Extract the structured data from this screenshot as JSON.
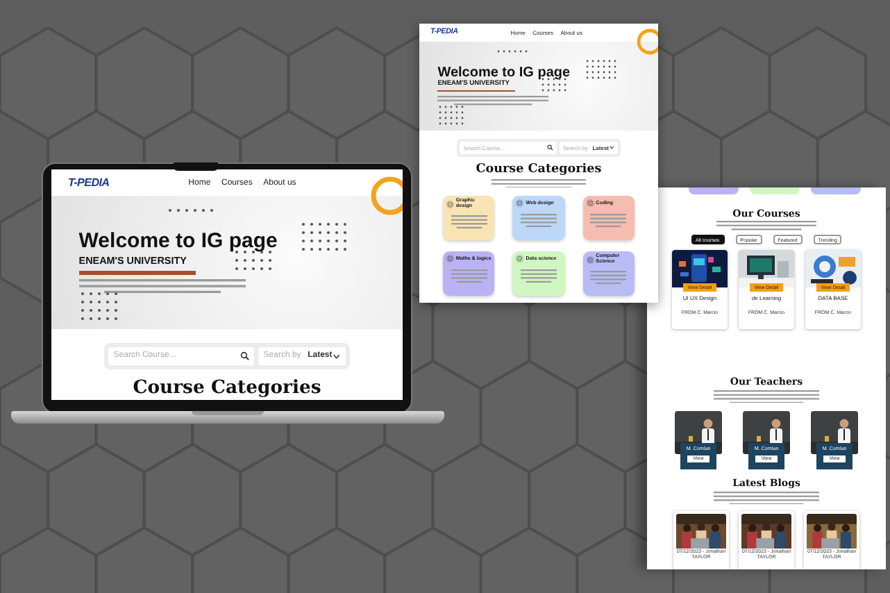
{
  "laptop_page": {
    "logo": "T-PEDIA",
    "nav": [
      {
        "label": "Home"
      },
      {
        "label": "Courses"
      },
      {
        "label": "About us"
      }
    ],
    "hero": {
      "title": "Welcome to IG page",
      "subtitle": "ENEAM'S UNIVERSITY"
    },
    "search": {
      "placeholder": "Search Course...",
      "sort_label": "Search by",
      "sort_value": "Latest"
    },
    "section_title": "Course Categories"
  },
  "preview_page_top": {
    "logo": "T-PEDIA",
    "nav": [
      {
        "label": "Home"
      },
      {
        "label": "Courses"
      },
      {
        "label": "About us"
      }
    ],
    "hero": {
      "title": "Welcome to IG page",
      "subtitle": "ENEAM'S UNIVERSITY"
    },
    "search": {
      "placeholder": "Search Course...",
      "sort_label": "Search by",
      "sort_value": "Latest"
    },
    "section_title": "Course Categories",
    "categories": [
      {
        "name": "Graphic design",
        "color": "#f9e4b4"
      },
      {
        "name": "Web design",
        "color": "#bcd7f8"
      },
      {
        "name": "Coding",
        "color": "#f7bcb0"
      },
      {
        "name": "Maths & logics",
        "color": "#b9b3f4"
      },
      {
        "name": "Data science",
        "color": "#d0f7c2"
      },
      {
        "name": "Computer Science",
        "color": "#b7bcf6"
      }
    ]
  },
  "preview_page_bottom": {
    "category_cards": [
      {
        "color": "#b9b3f4"
      },
      {
        "color": "#d0f7c2"
      },
      {
        "color": "#b7bcf6"
      }
    ],
    "courses_title": "Our Courses",
    "filters": [
      {
        "label": "All courses",
        "selected": true
      },
      {
        "label": "Popular",
        "selected": false
      },
      {
        "label": "Featured",
        "selected": false
      },
      {
        "label": "Trending",
        "selected": false
      }
    ],
    "courses": [
      {
        "kind": "picture",
        "title": "UI UX Design",
        "button": "View Detail",
        "author": "FROM C. Marcio"
      },
      {
        "kind": "picture",
        "title": "de Learning",
        "button": "View Detail",
        "author": "FROM C. Marcio"
      },
      {
        "kind": "picture",
        "title": "DATA BASE",
        "button": "View Detail",
        "author": "FROM C. Marcio"
      }
    ],
    "teachers_title": "Our Teachers",
    "teachers": [
      {
        "name": "M. Comlan",
        "button": "View"
      },
      {
        "name": "M. Comlan",
        "button": "View"
      },
      {
        "name": "M. Comlan",
        "button": "View"
      }
    ],
    "blogs_title": "Latest Blogs",
    "blogs": [
      {
        "meta": "07/12/2023 - Jonathan TAYLOR"
      },
      {
        "meta": "07/12/2023 - Jonathan TAYLOR"
      },
      {
        "meta": "07/12/2023 - Jonathan TAYLOR"
      }
    ]
  }
}
